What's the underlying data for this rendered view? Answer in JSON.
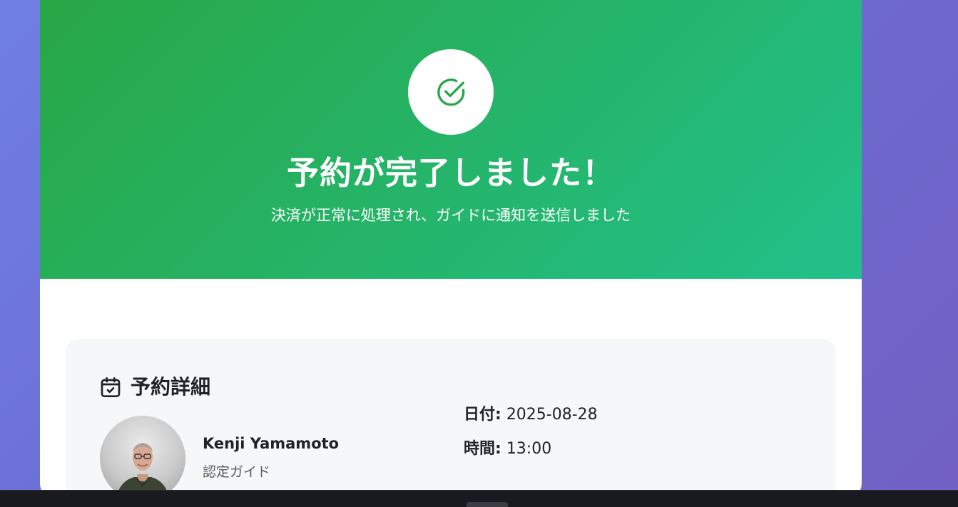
{
  "hero": {
    "title": "予約が完了しました！",
    "subtitle": "決済が正常に処理され、ガイドに通知を送信しました",
    "icon": "check-circle-icon",
    "gradient_start": "#28a745",
    "gradient_end": "#22c08a"
  },
  "details": {
    "icon": "calendar-check-icon",
    "title": "予約詳細",
    "guide": {
      "name": "Kenji Yamamoto",
      "role": "認定ガイド"
    },
    "date_label": "日付:",
    "date_value": "2025-08-28",
    "time_label": "時間:",
    "time_value": "13:00"
  }
}
